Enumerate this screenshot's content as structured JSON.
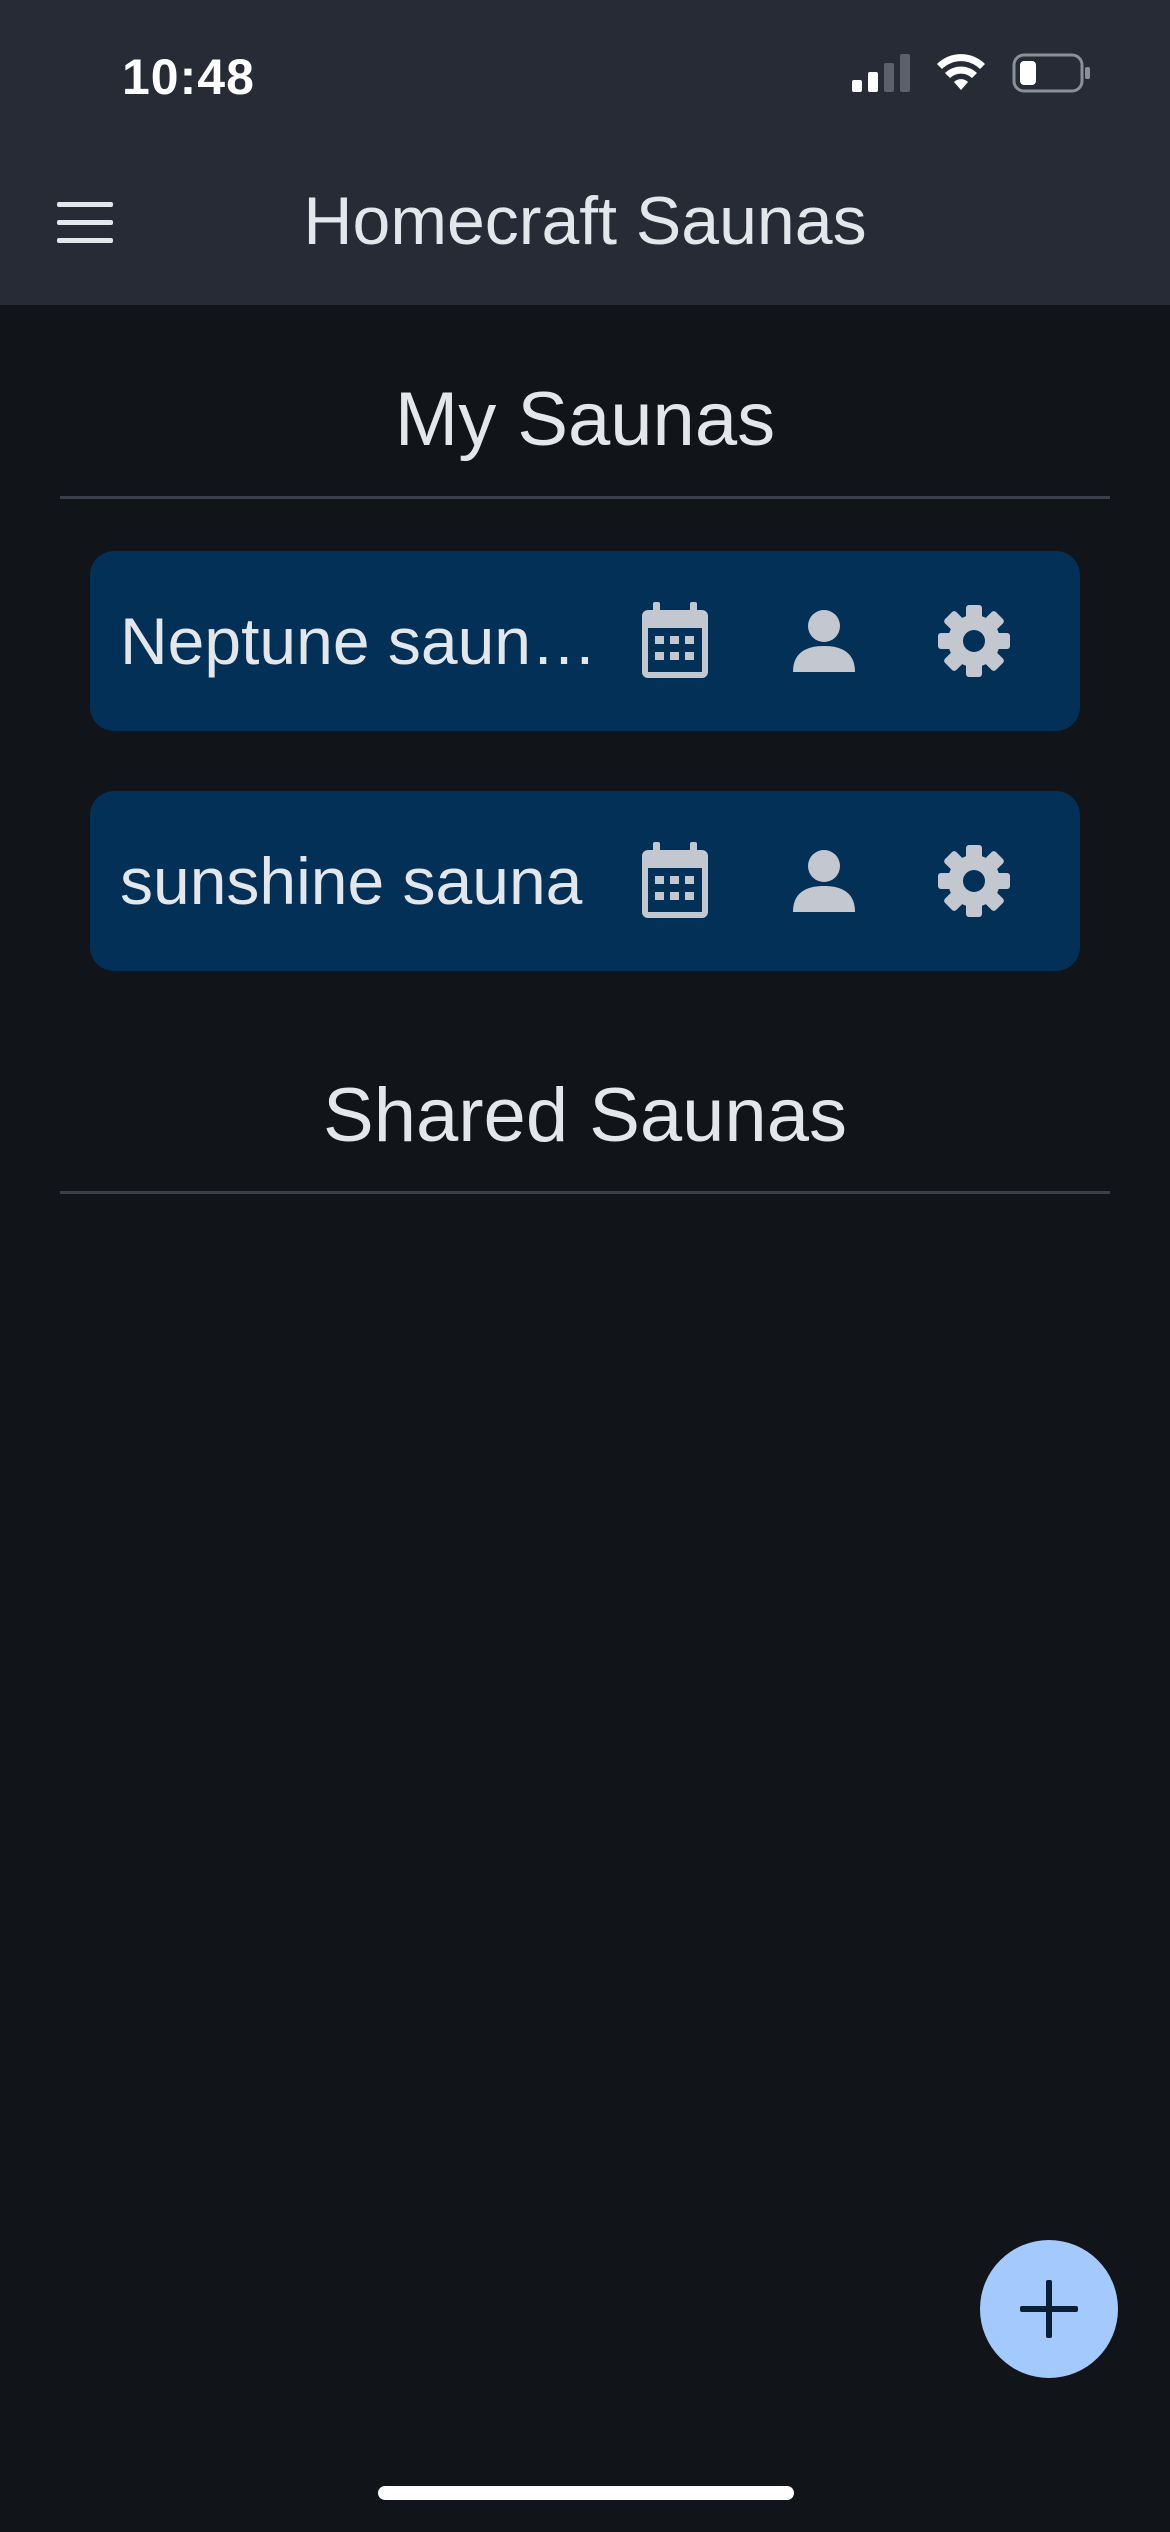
{
  "status_bar": {
    "time": "10:48"
  },
  "header": {
    "title": "Homecraft Saunas",
    "menu_icon": "hamburger-menu-icon"
  },
  "my_saunas": {
    "title": "My Saunas",
    "items": [
      {
        "name": "Neptune saun…"
      },
      {
        "name": "sunshine sauna"
      }
    ],
    "item_icons": [
      "calendar-icon",
      "person-icon",
      "gear-icon"
    ]
  },
  "shared_saunas": {
    "title": "Shared Saunas",
    "items": []
  },
  "fab": {
    "icon": "plus-icon"
  },
  "colors": {
    "background": "#111419",
    "app_bar": "#272b36",
    "card": "#023056",
    "icon": "#c3c7cf",
    "fab": "#a4c9fd",
    "fab_icon": "#0a1f33",
    "text": "#e3e6ea"
  }
}
